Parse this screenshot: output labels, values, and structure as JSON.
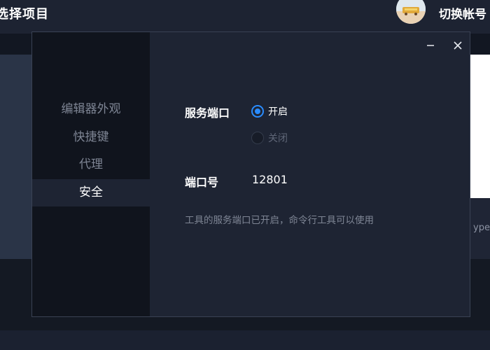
{
  "app": {
    "title": "选择项目",
    "switch_account_label": "切换帐号"
  },
  "background": {
    "partial_text": "ype"
  },
  "sidebar": {
    "items": [
      {
        "label": "编辑器外观"
      },
      {
        "label": "快捷键"
      },
      {
        "label": "代理"
      },
      {
        "label": "安全"
      }
    ],
    "active_index": 3
  },
  "security": {
    "service_port_label": "服务端口",
    "options": [
      {
        "label": "开启",
        "selected": true
      },
      {
        "label": "关闭",
        "selected": false
      }
    ],
    "port_number_label": "端口号",
    "port_number_value": "12801",
    "hint": "工具的服务端口已开启，命令行工具可以使用"
  },
  "colors": {
    "accent": "#2a8cff",
    "modal_bg": "#1e2433",
    "sidebar_bg": "#10141d"
  },
  "icons": {
    "minimize": "minimize-icon",
    "close": "close-icon"
  }
}
